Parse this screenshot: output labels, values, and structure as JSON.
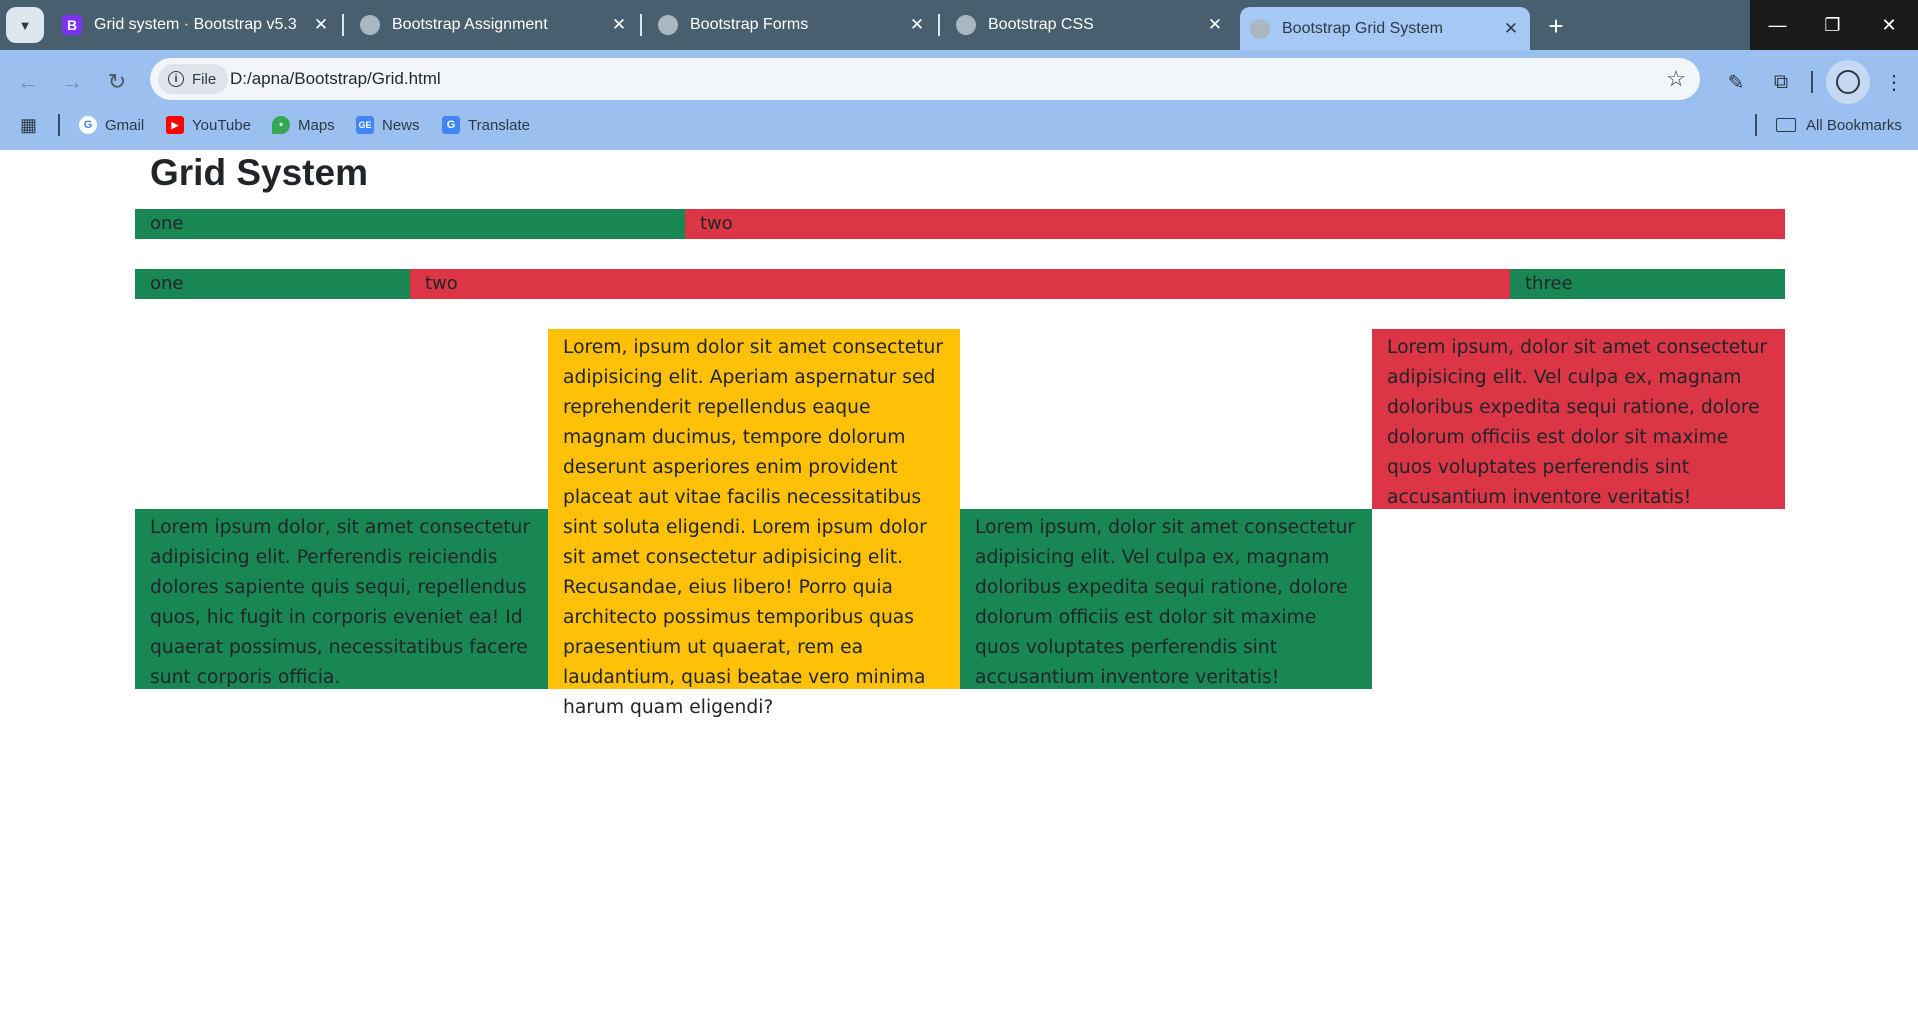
{
  "browser": {
    "tabs": [
      {
        "title": "Grid system · Bootstrap v5.3",
        "favicon": "bootstrap-icon"
      },
      {
        "title": "Bootstrap Assignment",
        "favicon": "globe-icon"
      },
      {
        "title": "Bootstrap Forms",
        "favicon": "globe-icon"
      },
      {
        "title": "Bootstrap CSS",
        "favicon": "globe-icon"
      },
      {
        "title": "Bootstrap Grid System",
        "favicon": "globe-icon",
        "active": true
      }
    ],
    "address": {
      "chip_label": "File",
      "url": "D:/apna/Bootstrap/Grid.html"
    },
    "bookmarks": [
      {
        "label": "Gmail",
        "icon": "google-icon"
      },
      {
        "label": "YouTube",
        "icon": "youtube-icon"
      },
      {
        "label": "Maps",
        "icon": "maps-icon"
      },
      {
        "label": "News",
        "icon": "news-icon"
      },
      {
        "label": "Translate",
        "icon": "translate-icon"
      }
    ],
    "all_bookmarks_label": "All Bookmarks"
  },
  "page": {
    "title": "Grid System",
    "row1": [
      "one",
      "two"
    ],
    "row2": [
      "one",
      "two",
      "three"
    ],
    "paragraphs": {
      "yellow": "Lorem, ipsum dolor sit amet consectetur adipisicing elit. Aperiam aspernatur sed reprehenderit repellendus eaque magnam ducimus, tempore dolorum deserunt asperiores enim provident placeat aut vitae facilis necessitatibus sint soluta eligendi. Lorem ipsum dolor sit amet consectetur adipisicing elit. Recusandae, eius libero! Porro quia architecto possimus temporibus quas praesentium ut quaerat, rem ea laudantium, quasi beatae vero minima harum quam eligendi?",
      "red": "Lorem ipsum, dolor sit amet consectetur adipisicing elit. Vel culpa ex, magnam doloribus expedita sequi ratione, dolore dolorum officiis est dolor sit maxime quos voluptates perferendis sint accusantium inventore veritatis!",
      "green_left": "Lorem ipsum dolor, sit amet consectetur adipisicing elit. Perferendis reiciendis dolores sapiente quis sequi, repellendus quos, hic fugit in corporis eveniet ea! Id quaerat possimus, necessitatibus facere sunt corporis officia.",
      "green_right": "Lorem ipsum, dolor sit amet consectetur adipisicing elit. Vel culpa ex, magnam doloribus expedita sequi ratione, dolore dolorum officiis est dolor sit maxime quos voluptates perferendis sint accusantium inventore veritatis!"
    },
    "colors": {
      "green": "#198754",
      "red": "#dc3545",
      "yellow": "#ffc107"
    }
  }
}
